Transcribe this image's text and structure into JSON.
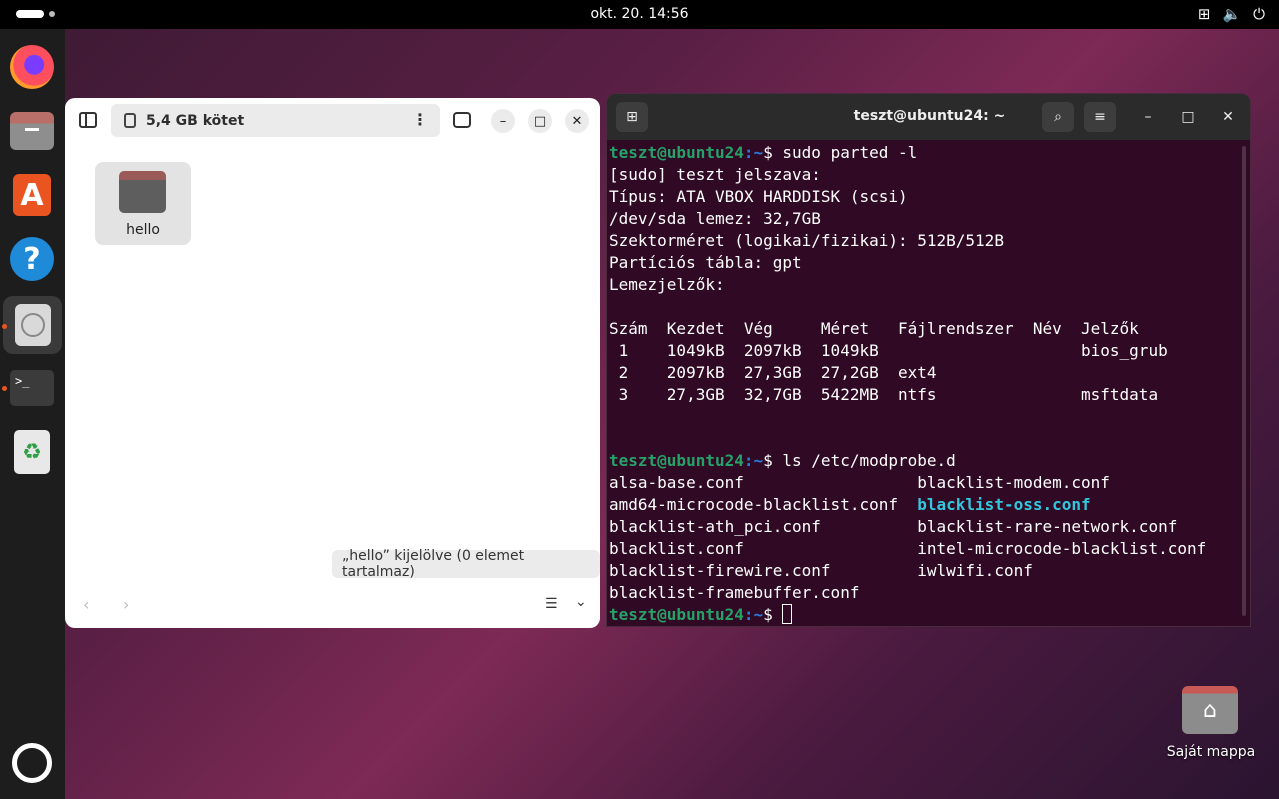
{
  "topbar": {
    "clock": "okt. 20.  14:56",
    "tray_icons": [
      "network-icon",
      "volume-icon",
      "power-icon"
    ]
  },
  "dock": {
    "items": [
      "firefox",
      "files",
      "app-center",
      "help",
      "disks",
      "terminal",
      "trash",
      "show-apps"
    ]
  },
  "file_manager": {
    "path_label": "5,4 GB kötet",
    "folder_name": "hello",
    "status": "„hello” kijelölve  (0 elemet tartalmaz)"
  },
  "terminal": {
    "title": "teszt@ubuntu24: ~",
    "prompt_user": "teszt@ubuntu24",
    "prompt_path": ":~",
    "prompt_sign": "$",
    "lines": [
      {
        "type": "cmd",
        "text": " sudo parted -l"
      },
      {
        "type": "out",
        "text": "[sudo] teszt jelszava:"
      },
      {
        "type": "out",
        "text": "Típus: ATA VBOX HARDDISK (scsi)"
      },
      {
        "type": "out",
        "text": "/dev/sda lemez: 32,7GB"
      },
      {
        "type": "out",
        "text": "Szektorméret (logikai/fizikai): 512B/512B"
      },
      {
        "type": "out",
        "text": "Partíciós tábla: gpt"
      },
      {
        "type": "out",
        "text": "Lemezjelzők:"
      },
      {
        "type": "out",
        "text": ""
      },
      {
        "type": "out",
        "text": "Szám  Kezdet  Vég     Méret   Fájlrendszer  Név  Jelzők"
      },
      {
        "type": "out",
        "text": " 1    1049kB  2097kB  1049kB                     bios_grub"
      },
      {
        "type": "out",
        "text": " 2    2097kB  27,3GB  27,2GB  ext4"
      },
      {
        "type": "out",
        "text": " 3    27,3GB  32,7GB  5422MB  ntfs               msftdata"
      },
      {
        "type": "out",
        "text": ""
      },
      {
        "type": "out",
        "text": ""
      },
      {
        "type": "cmd",
        "text": " ls /etc/modprobe.d"
      },
      {
        "type": "out",
        "text": "alsa-base.conf                  blacklist-modem.conf"
      },
      {
        "type": "mixed",
        "text": "amd64-microcode-blacklist.conf  ",
        "hl": "blacklist-oss.conf"
      },
      {
        "type": "out",
        "text": "blacklist-ath_pci.conf          blacklist-rare-network.conf"
      },
      {
        "type": "out",
        "text": "blacklist.conf                  intel-microcode-blacklist.conf"
      },
      {
        "type": "out",
        "text": "blacklist-firewire.conf         iwlwifi.conf"
      },
      {
        "type": "out",
        "text": "blacklist-framebuffer.conf"
      },
      {
        "type": "prompt",
        "text": " "
      }
    ]
  },
  "desktop": {
    "home_label": "Saját mappa"
  }
}
